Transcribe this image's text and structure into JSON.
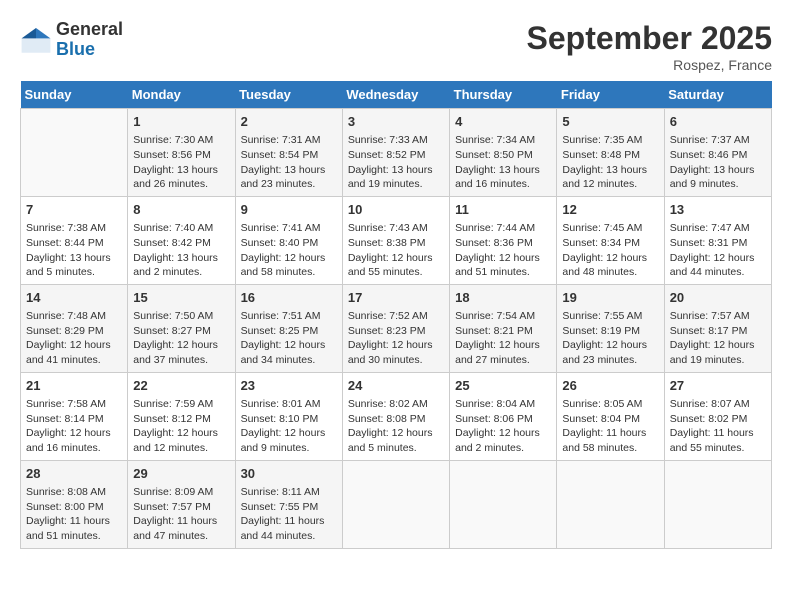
{
  "header": {
    "logo_general": "General",
    "logo_blue": "Blue",
    "month_title": "September 2025",
    "location": "Rospez, France"
  },
  "days_of_week": [
    "Sunday",
    "Monday",
    "Tuesday",
    "Wednesday",
    "Thursday",
    "Friday",
    "Saturday"
  ],
  "weeks": [
    [
      {
        "day": "",
        "info": ""
      },
      {
        "day": "1",
        "info": "Sunrise: 7:30 AM\nSunset: 8:56 PM\nDaylight: 13 hours and 26 minutes."
      },
      {
        "day": "2",
        "info": "Sunrise: 7:31 AM\nSunset: 8:54 PM\nDaylight: 13 hours and 23 minutes."
      },
      {
        "day": "3",
        "info": "Sunrise: 7:33 AM\nSunset: 8:52 PM\nDaylight: 13 hours and 19 minutes."
      },
      {
        "day": "4",
        "info": "Sunrise: 7:34 AM\nSunset: 8:50 PM\nDaylight: 13 hours and 16 minutes."
      },
      {
        "day": "5",
        "info": "Sunrise: 7:35 AM\nSunset: 8:48 PM\nDaylight: 13 hours and 12 minutes."
      },
      {
        "day": "6",
        "info": "Sunrise: 7:37 AM\nSunset: 8:46 PM\nDaylight: 13 hours and 9 minutes."
      }
    ],
    [
      {
        "day": "7",
        "info": "Sunrise: 7:38 AM\nSunset: 8:44 PM\nDaylight: 13 hours and 5 minutes."
      },
      {
        "day": "8",
        "info": "Sunrise: 7:40 AM\nSunset: 8:42 PM\nDaylight: 13 hours and 2 minutes."
      },
      {
        "day": "9",
        "info": "Sunrise: 7:41 AM\nSunset: 8:40 PM\nDaylight: 12 hours and 58 minutes."
      },
      {
        "day": "10",
        "info": "Sunrise: 7:43 AM\nSunset: 8:38 PM\nDaylight: 12 hours and 55 minutes."
      },
      {
        "day": "11",
        "info": "Sunrise: 7:44 AM\nSunset: 8:36 PM\nDaylight: 12 hours and 51 minutes."
      },
      {
        "day": "12",
        "info": "Sunrise: 7:45 AM\nSunset: 8:34 PM\nDaylight: 12 hours and 48 minutes."
      },
      {
        "day": "13",
        "info": "Sunrise: 7:47 AM\nSunset: 8:31 PM\nDaylight: 12 hours and 44 minutes."
      }
    ],
    [
      {
        "day": "14",
        "info": "Sunrise: 7:48 AM\nSunset: 8:29 PM\nDaylight: 12 hours and 41 minutes."
      },
      {
        "day": "15",
        "info": "Sunrise: 7:50 AM\nSunset: 8:27 PM\nDaylight: 12 hours and 37 minutes."
      },
      {
        "day": "16",
        "info": "Sunrise: 7:51 AM\nSunset: 8:25 PM\nDaylight: 12 hours and 34 minutes."
      },
      {
        "day": "17",
        "info": "Sunrise: 7:52 AM\nSunset: 8:23 PM\nDaylight: 12 hours and 30 minutes."
      },
      {
        "day": "18",
        "info": "Sunrise: 7:54 AM\nSunset: 8:21 PM\nDaylight: 12 hours and 27 minutes."
      },
      {
        "day": "19",
        "info": "Sunrise: 7:55 AM\nSunset: 8:19 PM\nDaylight: 12 hours and 23 minutes."
      },
      {
        "day": "20",
        "info": "Sunrise: 7:57 AM\nSunset: 8:17 PM\nDaylight: 12 hours and 19 minutes."
      }
    ],
    [
      {
        "day": "21",
        "info": "Sunrise: 7:58 AM\nSunset: 8:14 PM\nDaylight: 12 hours and 16 minutes."
      },
      {
        "day": "22",
        "info": "Sunrise: 7:59 AM\nSunset: 8:12 PM\nDaylight: 12 hours and 12 minutes."
      },
      {
        "day": "23",
        "info": "Sunrise: 8:01 AM\nSunset: 8:10 PM\nDaylight: 12 hours and 9 minutes."
      },
      {
        "day": "24",
        "info": "Sunrise: 8:02 AM\nSunset: 8:08 PM\nDaylight: 12 hours and 5 minutes."
      },
      {
        "day": "25",
        "info": "Sunrise: 8:04 AM\nSunset: 8:06 PM\nDaylight: 12 hours and 2 minutes."
      },
      {
        "day": "26",
        "info": "Sunrise: 8:05 AM\nSunset: 8:04 PM\nDaylight: 11 hours and 58 minutes."
      },
      {
        "day": "27",
        "info": "Sunrise: 8:07 AM\nSunset: 8:02 PM\nDaylight: 11 hours and 55 minutes."
      }
    ],
    [
      {
        "day": "28",
        "info": "Sunrise: 8:08 AM\nSunset: 8:00 PM\nDaylight: 11 hours and 51 minutes."
      },
      {
        "day": "29",
        "info": "Sunrise: 8:09 AM\nSunset: 7:57 PM\nDaylight: 11 hours and 47 minutes."
      },
      {
        "day": "30",
        "info": "Sunrise: 8:11 AM\nSunset: 7:55 PM\nDaylight: 11 hours and 44 minutes."
      },
      {
        "day": "",
        "info": ""
      },
      {
        "day": "",
        "info": ""
      },
      {
        "day": "",
        "info": ""
      },
      {
        "day": "",
        "info": ""
      }
    ]
  ]
}
